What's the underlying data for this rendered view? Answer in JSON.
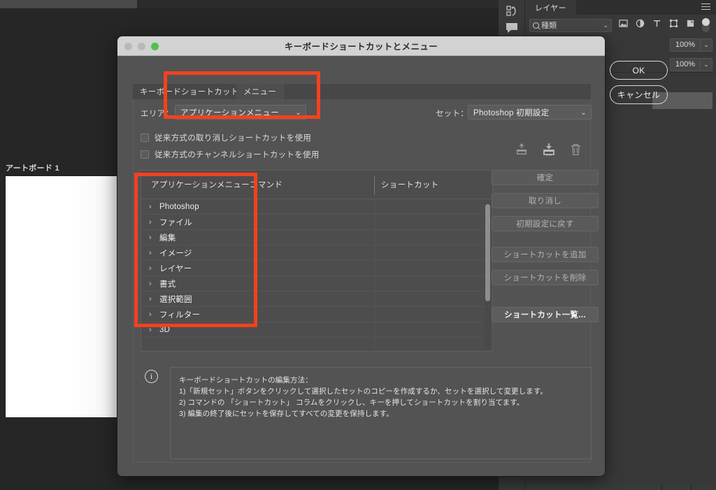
{
  "background_app": {
    "canvas": {
      "artboard_label": "アートボード 1"
    },
    "rail_icons": [
      {
        "name": "history-icon"
      },
      {
        "name": "comment-icon"
      }
    ],
    "layers_panel": {
      "tab_label": "レイヤー",
      "menu_icon": "panel-menu-icon",
      "filter": {
        "search_icon": "search-icon",
        "kind_value": "種類",
        "caret_icon": "chevron-down-icon"
      },
      "filter_icons": [
        {
          "name": "image-filter-icon"
        },
        {
          "name": "adjustment-filter-icon"
        },
        {
          "name": "type-filter-icon"
        },
        {
          "name": "shape-filter-icon"
        },
        {
          "name": "smartobject-filter-icon"
        }
      ],
      "filter_toggle": "filter-enable-toggle",
      "opacity_value": "100%",
      "fill_value": "100%"
    }
  },
  "dialog": {
    "title": "キーボードショートカットとメニュー",
    "window_controls": {
      "close": "close-button",
      "minimize": "minimize-button",
      "zoom": "zoom-button"
    },
    "tabs": [
      {
        "label": "キーボードショートカット",
        "active": true
      },
      {
        "label": "メニュー",
        "active": false
      }
    ],
    "area": {
      "label": "エリア：",
      "value": "アプリケーションメニュー",
      "caret_icon": "chevron-down-icon"
    },
    "set": {
      "label": "セット：",
      "value": "Photoshop 初期設定",
      "caret_icon": "chevron-down-icon"
    },
    "set_actions": [
      {
        "name": "save-set-icon"
      },
      {
        "name": "save-set-as-icon"
      },
      {
        "name": "delete-set-icon"
      }
    ],
    "checkboxes": [
      {
        "label": "従来方式の取り消しショートカットを使用",
        "checked": false
      },
      {
        "label": "従来方式のチャンネルショートカットを使用",
        "checked": false
      }
    ],
    "list": {
      "columns": [
        "アプリケーションメニューコマンド",
        "ショートカット"
      ],
      "rows": [
        {
          "name": "Photoshop",
          "shortcut": ""
        },
        {
          "name": "ファイル",
          "shortcut": ""
        },
        {
          "name": "編集",
          "shortcut": ""
        },
        {
          "name": "イメージ",
          "shortcut": ""
        },
        {
          "name": "レイヤー",
          "shortcut": ""
        },
        {
          "name": "書式",
          "shortcut": ""
        },
        {
          "name": "選択範囲",
          "shortcut": ""
        },
        {
          "name": "フィルター",
          "shortcut": ""
        },
        {
          "name": "3D",
          "shortcut": ""
        },
        {
          "name": "",
          "shortcut": ""
        }
      ],
      "expand_icon": "chevron-right-icon"
    },
    "side_buttons": [
      {
        "label": "確定",
        "enabled": false
      },
      {
        "label": "取り消し",
        "enabled": false
      },
      {
        "label": "初期設定に戻す",
        "enabled": false
      },
      {
        "label": "ショートカットを追加",
        "enabled": false
      },
      {
        "label": "ショートカットを削除",
        "enabled": false
      },
      {
        "label": "ショートカット一覧...",
        "enabled": true
      }
    ],
    "info": {
      "icon": "info-icon",
      "lines": [
        "キーボードショートカットの編集方法：",
        "1)「新規セット」ボタンをクリックして選択したセットのコピーを作成するか、セットを選択して変更します。",
        "2) コマンドの 「ショートカット」 コラムをクリックし、キーを押してショートカットを割り当てます。",
        "3) 編集の終了後にセットを保存してすべての変更を保持します。"
      ]
    },
    "primary_buttons": [
      {
        "label": "OK"
      },
      {
        "label": "キャンセル"
      }
    ]
  },
  "annotations": {
    "accent_color": "#f4411f",
    "boxes": [
      {
        "name": "area-dropdown-highlight"
      },
      {
        "name": "menu-list-highlight"
      }
    ]
  }
}
